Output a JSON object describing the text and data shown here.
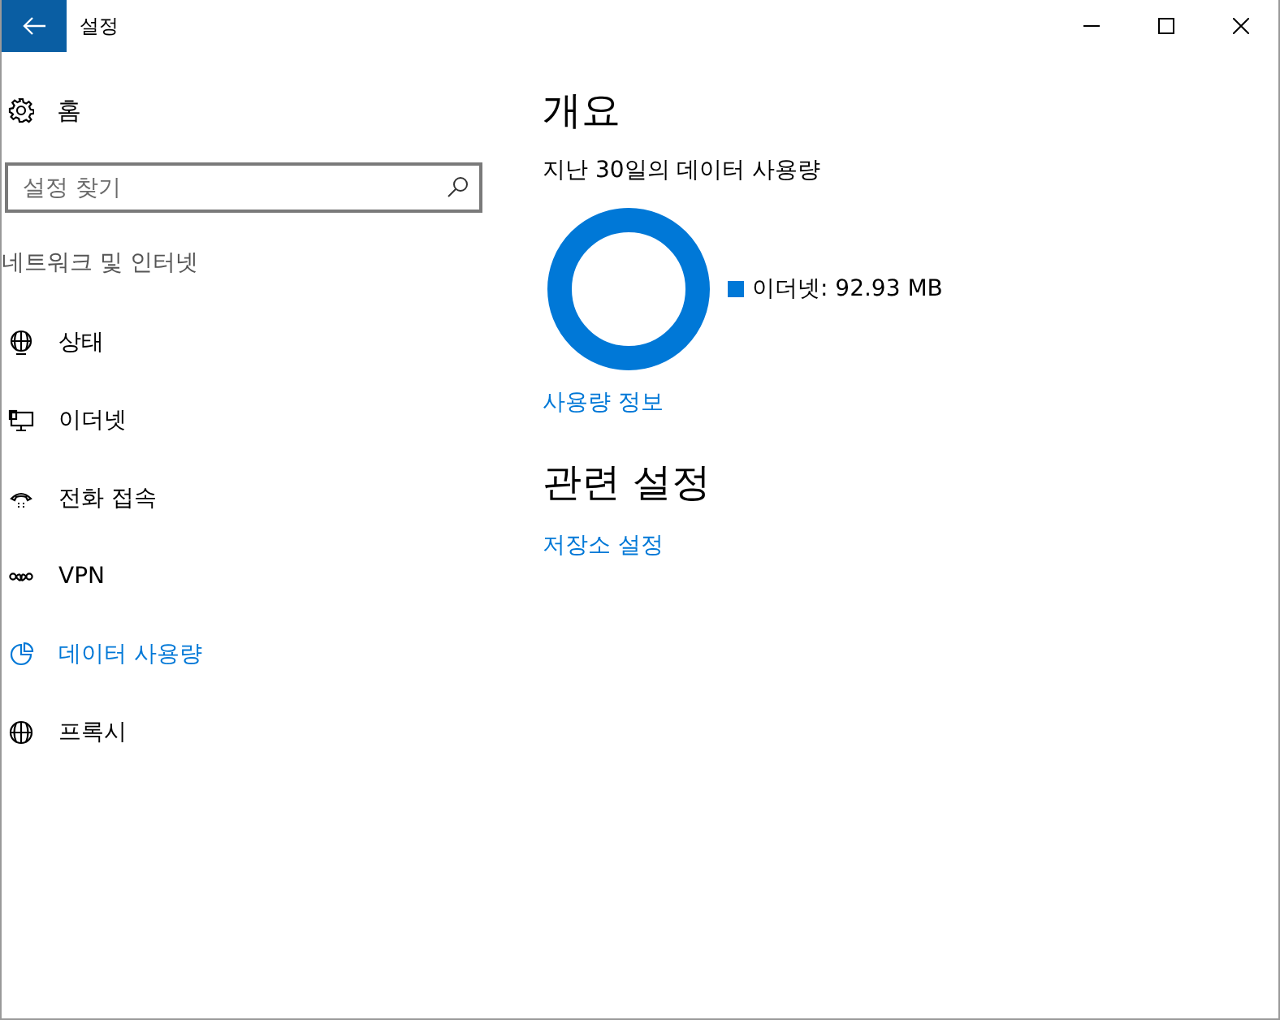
{
  "window": {
    "title": "설정"
  },
  "sidebar": {
    "home": "홈",
    "search": {
      "placeholder": "설정 찾기"
    },
    "section": "네트워크 및 인터넷",
    "items": [
      {
        "label": "상태",
        "selected": false
      },
      {
        "label": "이더넷",
        "selected": false
      },
      {
        "label": "전화 접속",
        "selected": false
      },
      {
        "label": "VPN",
        "selected": false
      },
      {
        "label": "데이터 사용량",
        "selected": true
      },
      {
        "label": "프록시",
        "selected": false
      }
    ]
  },
  "main": {
    "title": "개요",
    "subtitle": "지난 30일의 데이터 사용량",
    "legend": [
      {
        "label": "이더넷: 92.93 MB",
        "color": "#0078d7"
      }
    ],
    "usage_link": "사용량 정보",
    "related_title": "관련 설정",
    "related_links": [
      "저장소 설정"
    ]
  }
}
